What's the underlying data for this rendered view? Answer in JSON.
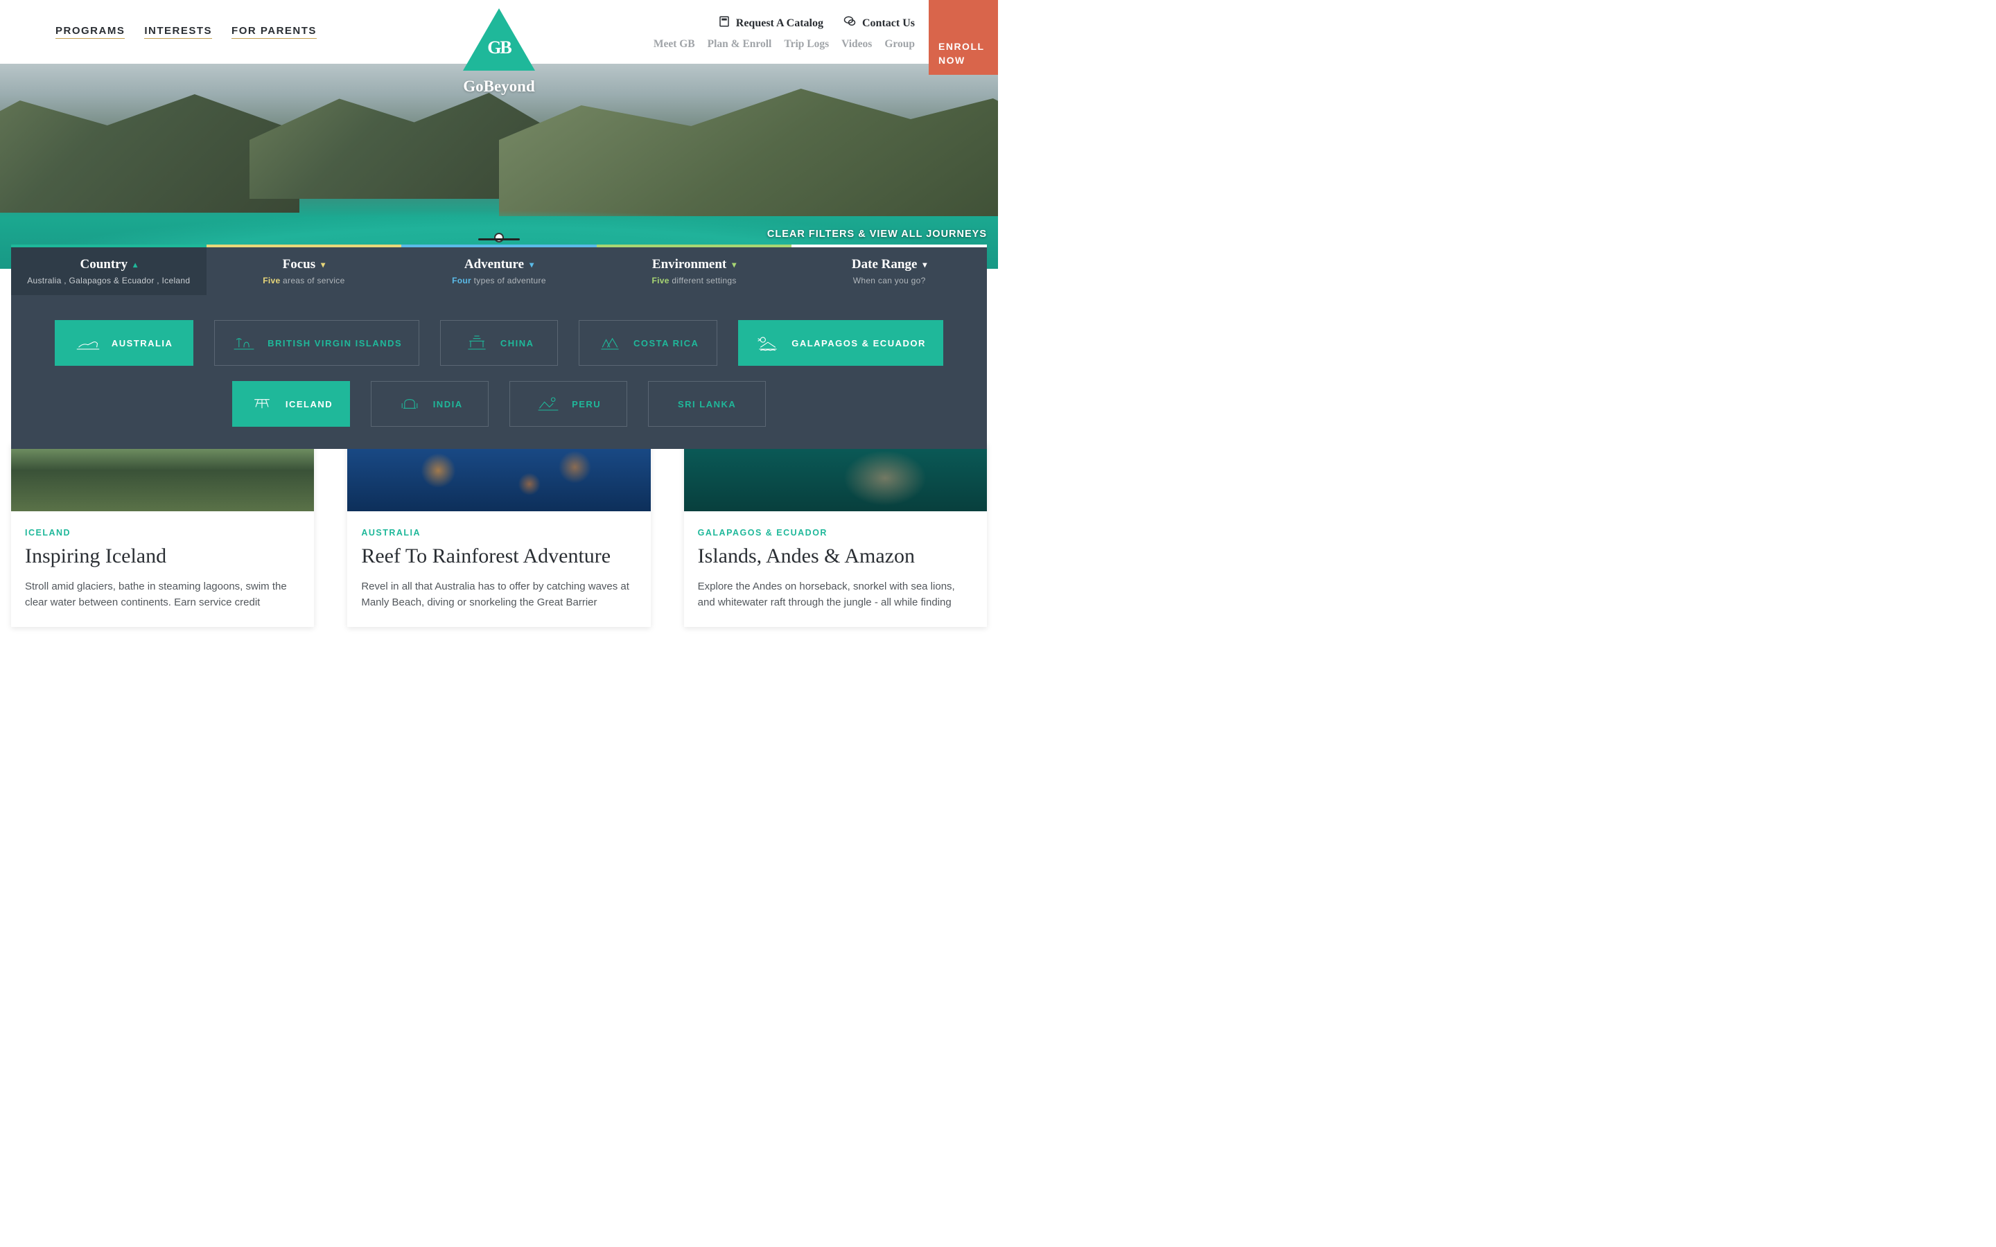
{
  "header": {
    "nav_left": [
      "PROGRAMS",
      "INTERESTS",
      "FOR PARENTS"
    ],
    "utility": {
      "catalog": "Request A Catalog",
      "contact": "Contact Us"
    },
    "nav_right": [
      "Meet GB",
      "Plan & Enroll",
      "Trip Logs",
      "Videos",
      "Group"
    ],
    "enroll": "ENROLL NOW",
    "logo_initials": "GB",
    "logo_text": "GoBeyond"
  },
  "hero": {
    "clear_filters": "CLEAR FILTERS & VIEW ALL JOURNEYS"
  },
  "tabs": [
    {
      "title": "Country",
      "subtitle_full": "Australia , Galapagos & Ecuador , Iceland",
      "chev": "up"
    },
    {
      "title": "Focus",
      "hl": "Five",
      "subtitle": " areas of service",
      "chev": "down"
    },
    {
      "title": "Adventure",
      "hl": "Four",
      "subtitle": " types of adventure",
      "chev": "down"
    },
    {
      "title": "Environment",
      "hl": "Five",
      "subtitle": " different settings",
      "chev": "down"
    },
    {
      "title": "Date Range",
      "subtitle_full": "When can you go?",
      "chev": "down"
    }
  ],
  "countries": {
    "row1": [
      {
        "label": "AUSTRALIA",
        "selected": true
      },
      {
        "label": "BRITISH VIRGIN ISLANDS",
        "selected": false
      },
      {
        "label": "CHINA",
        "selected": false
      },
      {
        "label": "COSTA RICA",
        "selected": false
      },
      {
        "label": "GALAPAGOS & ECUADOR",
        "selected": true
      }
    ],
    "row2": [
      {
        "label": "ICELAND",
        "selected": true
      },
      {
        "label": "INDIA",
        "selected": false
      },
      {
        "label": "PERU",
        "selected": false
      },
      {
        "label": "SRI LANKA",
        "selected": false
      }
    ]
  },
  "cards": [
    {
      "tag": "ICELAND",
      "title": "Inspiring Iceland",
      "desc": "Stroll amid glaciers, bathe in steaming lagoons, swim the clear water between continents. Earn service credit"
    },
    {
      "tag": "AUSTRALIA",
      "title": "Reef To Rainforest Adventure",
      "desc": "Revel in all that Australia has to offer by catching waves at Manly Beach, diving or snorkeling the Great Barrier"
    },
    {
      "tag": "GALAPAGOS & ECUADOR",
      "title": "Islands, Andes & Amazon",
      "desc": "Explore the Andes on horseback, snorkel with sea lions, and whitewater raft through the jungle - all while finding"
    }
  ]
}
